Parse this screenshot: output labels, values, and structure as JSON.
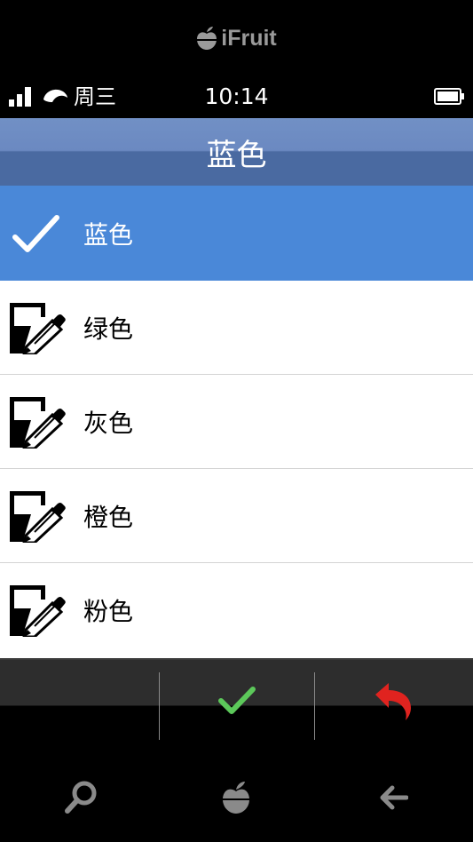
{
  "brand": {
    "name": "iFruit"
  },
  "status": {
    "day": "周三",
    "time": "10:14"
  },
  "title": "蓝色",
  "list": {
    "items": [
      {
        "label": "蓝色",
        "selected": true,
        "icon": "checkmark-icon"
      },
      {
        "label": "绿色",
        "selected": false,
        "icon": "edit-icon"
      },
      {
        "label": "灰色",
        "selected": false,
        "icon": "edit-icon"
      },
      {
        "label": "橙色",
        "selected": false,
        "icon": "edit-icon"
      },
      {
        "label": "粉色",
        "selected": false,
        "icon": "edit-icon"
      }
    ]
  },
  "actionbar": {
    "confirm_icon": "check-icon",
    "confirm_color": "#5cc85a",
    "back_icon": "undo-icon",
    "back_color": "#e0231f"
  },
  "navbar": {
    "items": [
      "search-icon",
      "ifruit-home-icon",
      "back-arrow-icon"
    ]
  },
  "colors": {
    "title_bar": "#6b89c1",
    "selected_row": "#4a88d8"
  }
}
